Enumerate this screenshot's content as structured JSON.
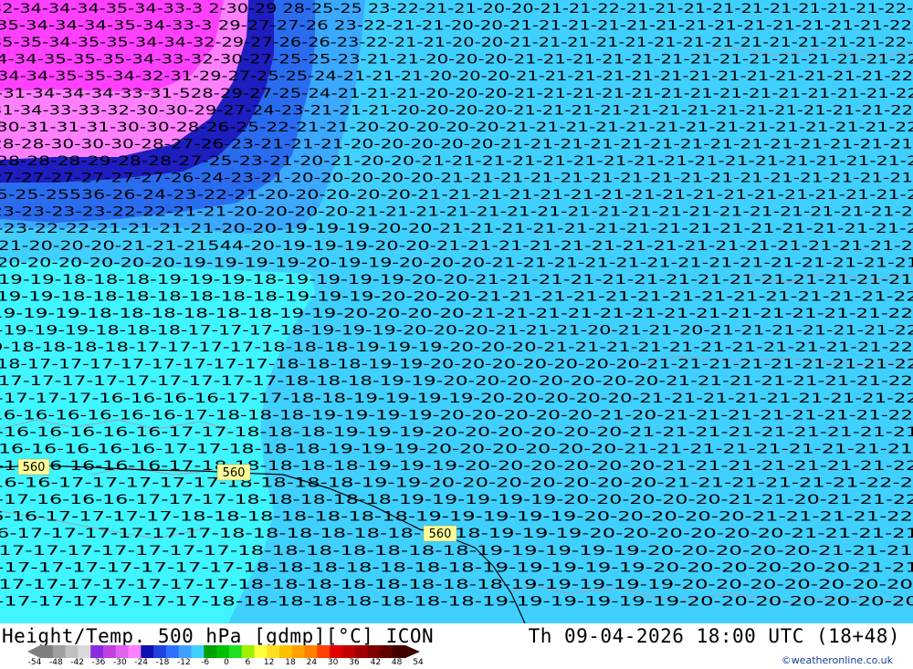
{
  "map": {
    "height_labels": [
      {
        "text": "560",
        "pos": "left"
      },
      {
        "text": "560",
        "pos": "center-left"
      },
      {
        "text": "560",
        "pos": "center"
      }
    ],
    "rows": [
      "32-34-34-34-35-34-33-3   2-30-29 28-25-25 23-22-21-21-20-20-21-21-22-21-21-21-21-21-21-21-21-21-22-",
      "35-34-34-34-35-34-33-3  29-27-27-26 23-22-21-21-20-20-21-21-21-21-21-21-21-21-21-21-21-21-21-22-",
      "35-35-34-35-35-34-34-32-29-27-26-26-23-22-21-21-20-20-21-21-21-21-21-21-21-21-21-21-21-21-21-22-",
      "4-34-35-35-35-34-33-32-30-27-25-25-23-21-21-20-20-20-21-21-21-21-21-21-21-21-21-21-21-21-21-22",
      "-34-34-35-35-34-32-31-29-27-25-25-24-21-21-21-20-20-20-21-21-21-21-21-21-21-21-21-21-21-21-21-22",
      "-31-34-34-34-33-31-528-29-27-25-24-21-21-21-20-20-20-21-21-21-21-21-21-21-21-21-21-21-21-21-22",
      "31-34-33-33-32-30-30-29-27-24-23-21-21-21-20-20-20-20-21-21-21-21-21-21-21-21-21-21-21-21-21-22",
      "30-31-31-31-30-30-28-26-25-22-21-21-20-20-20-20-20-21-21-21-21-21-21-21-21-21-21-21-21-21-22",
      "28-28-30-30-30-28-27-26-23-21-21-21-20-20-20-20-20-21-21-21-21-21-21-21-21-21-21-21-21-21-21",
      "28-28-28-29-28-28-27-25-23-21-20-21-20-20-21-21-21-21-21-21-21-21-21-21-21-21-21-21-21-21-2",
      "27-27-27-27-27-27-26-24-23-21-20-20-20-20-20-21-21-21-21-21-21-21-21-21-21-21-21-21-21-21-21",
      "5-25-25536-26-24-23-22-21-20-20-20-20-20-21-21-21-21-21-21-21-21-21-21-21-21-21-21-21-21-2",
      "23-23-23-23-22-22-21-21-20-20-20-20-21-21-21-21-21-21-21-21-21-21-21-21-21-21-21-21-21-21-2",
      "-23-22-22-21-21-21-21-20-20-19-19-19-20-20-21-21-21-21-21-21-21-21-21-21-21-21-21-21-21-2",
      "-21-20-20-20-21-21-21544-20-19-19-19-20-20-21-21-21-21-21-21-21-21-21-21-21-21-21-21-21-2",
      "20-20-20-20-20-20-19-19-19-19-20-19-19-20-20-20-21-21-21-21-21-21-21-21-21-21-21-21-21-21",
      "-19-19-18-18-18-19-19-19-18-19-19-19-19-20-20-21-21-21-21-21-21-21-21-21-21-21-21-21-21",
      "19-19-18-18-18-18-18-18-18-19-19-19-20-20-20-21-21-21-21-21-21-21-21-21-21-21-21-21-22",
      "19-19-19-18-18-18-18-18-18-19-19-20-20-20-20-21-21-21-21-21-21-21-21-21-21-21-21-21-22",
      "-19-19-19-18-18-18-17-17-17-18-19-19-19-20-20-20-21-21-21-20-21-21-20-21-21-21-21-21-21-22",
      "9-18-18-18-18-17-17-17-17-18-18-18-19-19-19-20-20-20-21-21-21-21-21-21-21-21-21-21-21-22",
      "18-17-17-17-17-17-17-17-17-18-18-18-19-19-20-20-20-20-20-20-20-21-21-21-21-21-21-21-21-22",
      "-17-17-17-17-17-17-17-17-17-18-18-18-19-19-20-20-20-20-20-20-20-21-21-21-21-21-21-21-22",
      "-17-17-17-16-16-16-16-17-17-18-18-19-19-19-19-20-20-20-20-20-21-21-21-21-21-21-21-21-22",
      "16-16-16-16-16-16-17-18-18-18-19-19-19-19-20-20-20-20-20-21-20-21-21-21-21-21-21-21-22",
      "-16-16-16-16-16-17-17-18-18-18-19-19-19-20-20-20-20-20-20-21-21-21-21-21-21-21-21-21",
      "-16-16-16-16-16-17-17-18-18-18-19-19-19-20-20-20-20-20-20-21-21-21-21-21-21-21-21-21",
      "-16-16-16-16-16-17-18-18-18-18-18-19-19-19-20-20-20-20-20-20-21-21-21-21-21-21-21-22",
      "16-16-17-17-17-17-17-18-18-18-18-19-19-20-20-20-20-20-20-20-21-21-21-21-21-21-22-2",
      "-17-16-16-16-17-17-17-18-18-18-18-18-19-19-19-19-19-20-20-20-20-20-21-21-20-21-21-22",
      "6-16-17-17-17-17-18-18-18-18-18-18-18-19-19-19-19-19-20-20-20-20-20-21-21-21-21-22",
      "6-17-17-17-17-17-17-18-18-18-18-18-18-18-18-19-19-19-20-20-20-20-20-20-21-21-21-21",
      "-17-17-17-17-17-17-17-18-18-18-18-18-18-18-19-19-19-19-19-20-20-20-20-20-21-21-21",
      "-17-17-17-17-17-17-17-18-18-18-18-18-18-18-19-19-19-19-19-20-20-20-20-20-20-21-21",
      "-17-17-17-17-17-17-17-18-18-18-18-18-18-18-18-19-19-19-19-19-20-20-20-20-20-20-20",
      "-17-17-17-17-17-17-18-18-18-18-18-18-18-18-19-19-19-19-19-19-20-20-20-20-20-20-20"
    ]
  },
  "footer": {
    "title_left": "Height/Temp. 500 hPa [gdmp][°C] ICON",
    "title_right": "Th 09-04-2026 18:00 UTC (18+48)",
    "credit": "©weatheronline.co.uk",
    "scale_ticks": [
      "-54",
      "-48",
      "-42",
      "-36",
      "-30",
      "-24",
      "-18",
      "-12",
      "-6",
      "0",
      "6",
      "12",
      "18",
      "24",
      "30",
      "36",
      "42",
      "48",
      "54"
    ],
    "scale_colors": [
      "#7f7f7f",
      "#a0a0a0",
      "#c0c0c0",
      "#dadada",
      "#8a2be2",
      "#c040e0",
      "#e060f0",
      "#ff80ff",
      "#1010b0",
      "#2040e0",
      "#3070ff",
      "#40a0ff",
      "#40d0ff",
      "#00a000",
      "#00c000",
      "#20e020",
      "#a0f000",
      "#ffff40",
      "#ffe020",
      "#ffc000",
      "#ffa000",
      "#ff8000",
      "#ff4000",
      "#e00000",
      "#c00000",
      "#a00000",
      "#800000",
      "#600000",
      "#400000"
    ]
  }
}
